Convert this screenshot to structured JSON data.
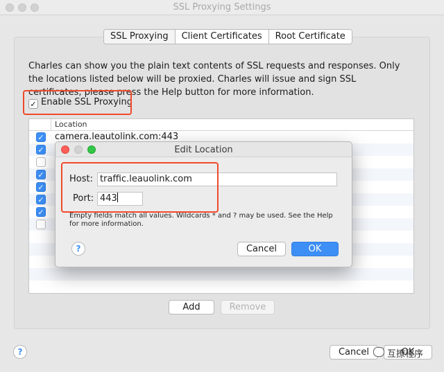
{
  "window": {
    "title": "SSL Proxying Settings"
  },
  "tabs": [
    {
      "label": "SSL Proxying"
    },
    {
      "label": "Client Certificates"
    },
    {
      "label": "Root Certificate"
    }
  ],
  "description": "Charles can show you the plain text contents of SSL requests and responses. Only the locations listed below will be proxied. Charles will issue and sign SSL certificates, please press the Help button for more information.",
  "enable_ssl": {
    "label": "Enable SSL Proxying",
    "checked": true
  },
  "table": {
    "column_header": "Location",
    "rows": [
      {
        "location": "camera.leautolink.com:443",
        "checked": true
      },
      {
        "location": "",
        "checked": true
      },
      {
        "location": "",
        "checked": false
      },
      {
        "location": "",
        "checked": true
      },
      {
        "location": "",
        "checked": true
      },
      {
        "location": "",
        "checked": true
      },
      {
        "location": "",
        "checked": true
      },
      {
        "location": "",
        "checked": false
      }
    ]
  },
  "buttons": {
    "add": "Add",
    "remove": "Remove",
    "cancel": "Cancel",
    "ok": "OK",
    "help": "?"
  },
  "dialog": {
    "title": "Edit Location",
    "host_label": "Host:",
    "host_value": "traffic.leauolink.com",
    "port_label": "Port:",
    "port_value": "443",
    "hint": "Empty fields match all values. Wildcards * and ? may be used. See the Help for more information.",
    "help": "?",
    "cancel": "Cancel",
    "ok": "OK"
  },
  "watermark": {
    "text": "互撩程序"
  },
  "colors": {
    "accent": "#3d8ff5",
    "highlight": "#ef4a2a"
  }
}
